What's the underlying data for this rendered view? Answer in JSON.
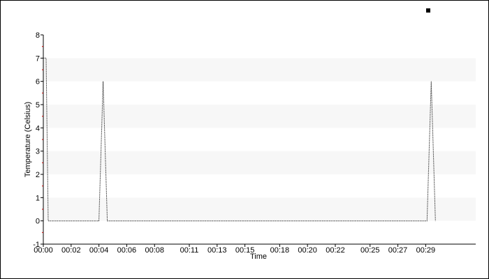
{
  "chart_data": {
    "type": "line",
    "title": "",
    "xlabel": "Time",
    "ylabel": "Temperature (Celsius)",
    "ylim": [
      -1,
      8
    ],
    "yticks": [
      -1,
      0,
      1,
      2,
      3,
      4,
      5,
      6,
      7,
      8
    ],
    "xtick_labels": [
      "00:00",
      "00:02",
      "00:04",
      "00:06",
      "00:08",
      "00:11",
      "00:13",
      "00:15",
      "00:18",
      "00:20",
      "00:22",
      "00:25",
      "00:27",
      "00:29"
    ],
    "x_unit": "minutes",
    "xlim": [
      0,
      31.1
    ],
    "xticks": [
      0,
      2,
      4,
      6,
      8,
      10.5,
      12.5,
      14.5,
      17,
      19,
      21,
      23.5,
      25.5,
      27.5
    ],
    "grid": "alternating horizontal bands",
    "legend": "top-right",
    "series": [
      {
        "name": "",
        "color": "#333333",
        "style": "dotted",
        "points": [
          [
            0,
            7
          ],
          [
            0.2,
            7
          ],
          [
            0.35,
            0
          ],
          [
            4.0,
            0
          ],
          [
            4.3,
            6
          ],
          [
            4.6,
            0
          ],
          [
            27.6,
            0
          ],
          [
            27.9,
            6
          ],
          [
            28.2,
            0
          ]
        ]
      }
    ],
    "minor_tick_color": "#cc0000",
    "band_color": "#f7f7f7"
  },
  "legend": {
    "marker_color": "#000000"
  }
}
